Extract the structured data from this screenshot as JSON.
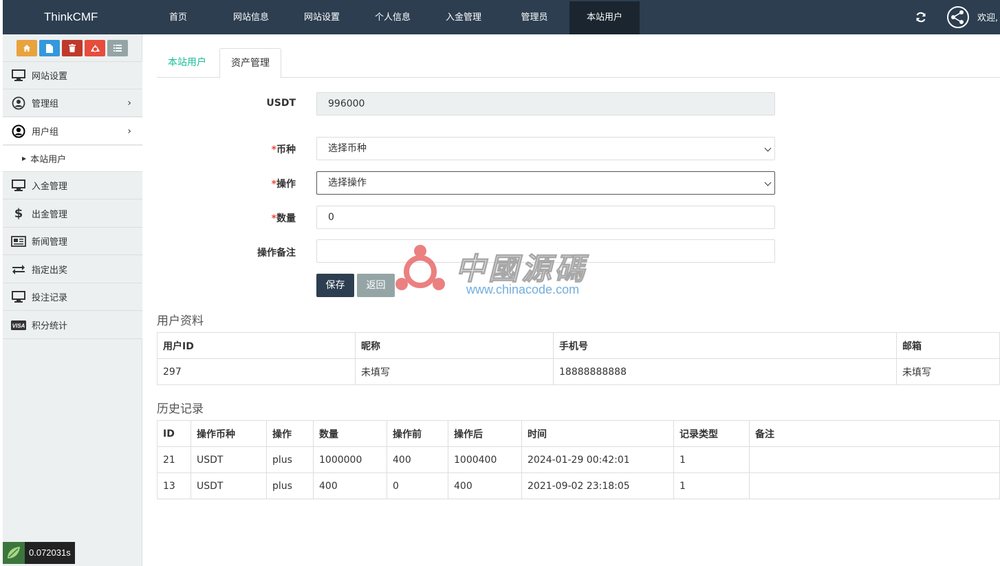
{
  "navbar": {
    "brand": "ThinkCMF",
    "items": [
      {
        "label": "首页"
      },
      {
        "label": "网站信息"
      },
      {
        "label": "网站设置"
      },
      {
        "label": "个人信息"
      },
      {
        "label": "入金管理"
      },
      {
        "label": "管理员"
      },
      {
        "label": "本站用户"
      }
    ],
    "active": "本站用户",
    "welcome": "欢迎,"
  },
  "sidebar": {
    "shortcuts": [
      {
        "icon": "home-icon",
        "color": "#e8a33d"
      },
      {
        "icon": "file-icon",
        "color": "#3498db"
      },
      {
        "icon": "trash-icon",
        "color": "#c0392b"
      },
      {
        "icon": "recycle-icon",
        "color": "#e74c3c"
      },
      {
        "icon": "list-icon",
        "color": "#95a5a6"
      }
    ],
    "items": [
      {
        "label": "网站设置",
        "icon": "monitor-icon"
      },
      {
        "label": "管理组",
        "icon": "user-circle-icon"
      },
      {
        "label": "用户组",
        "icon": "user-circle-icon"
      },
      {
        "label": "入金管理",
        "icon": "monitor-icon"
      },
      {
        "label": "出金管理",
        "icon": "dollar-icon"
      },
      {
        "label": "新闻管理",
        "icon": "newspaper-icon"
      },
      {
        "label": "指定出奖",
        "icon": "exchange-icon"
      },
      {
        "label": "投注记录",
        "icon": "monitor-icon"
      },
      {
        "label": "积分统计",
        "icon": "visa-icon"
      }
    ],
    "submenu_label": "本站用户"
  },
  "tabs": [
    {
      "label": "本站用户"
    },
    {
      "label": "资产管理"
    }
  ],
  "form": {
    "usdt_label": "USDT",
    "usdt_value": "996000",
    "currency_label": "币种",
    "currency_value": "选择币种",
    "operation_label": "操作",
    "operation_value": "选择操作",
    "amount_label": "数量",
    "amount_value": "0",
    "remark_label": "操作备注",
    "remark_value": "",
    "save_label": "保存",
    "back_label": "返回"
  },
  "user_info": {
    "title": "用户资料",
    "headers": [
      "用户ID",
      "昵称",
      "手机号",
      "邮箱"
    ],
    "row": [
      "297",
      "未填写",
      "18888888888",
      "未填写"
    ]
  },
  "history": {
    "title": "历史记录",
    "headers": [
      "ID",
      "操作币种",
      "操作",
      "数量",
      "操作前",
      "操作后",
      "时间",
      "记录类型",
      "备注"
    ],
    "rows": [
      [
        "21",
        "USDT",
        "plus",
        "1000000",
        "400",
        "1000400",
        "2024-01-29 00:42:01",
        "1",
        ""
      ],
      [
        "13",
        "USDT",
        "plus",
        "400",
        "0",
        "400",
        "2021-09-02 23:18:05",
        "1",
        ""
      ]
    ]
  },
  "timer": "0.072031s",
  "watermark": {
    "text": "中國源碼",
    "url": "www.chinacode.com"
  }
}
